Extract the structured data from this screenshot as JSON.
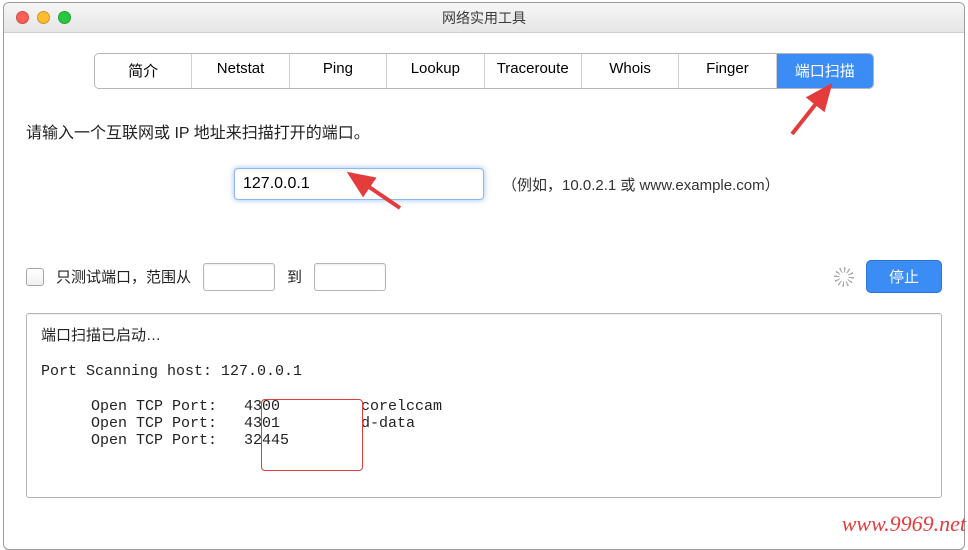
{
  "window": {
    "title": "网络实用工具"
  },
  "tabs": {
    "items": [
      "简介",
      "Netstat",
      "Ping",
      "Lookup",
      "Traceroute",
      "Whois",
      "Finger",
      "端口扫描"
    ],
    "active_index": 7
  },
  "main": {
    "prompt": "请输入一个互联网或 IP 地址来扫描打开的端口。",
    "address_value": "127.0.0.1",
    "hint": "（例如，10.0.2.1 或 www.example.com）",
    "only_test_label": "只测试端口，范围从",
    "to_label": "到",
    "range_from": "",
    "range_to": "",
    "stop_label": "停止"
  },
  "result": {
    "status": "端口扫描已启动…",
    "host_prefix": "Port Scanning host: ",
    "host": "127.0.0.1",
    "lines": [
      {
        "port": "4300",
        "service": "corelccam"
      },
      {
        "port": "4301",
        "service": "d-data"
      },
      {
        "port": "32445",
        "service": ""
      }
    ],
    "line_label": "Open TCP Port:"
  },
  "watermark": "www.9969.net"
}
